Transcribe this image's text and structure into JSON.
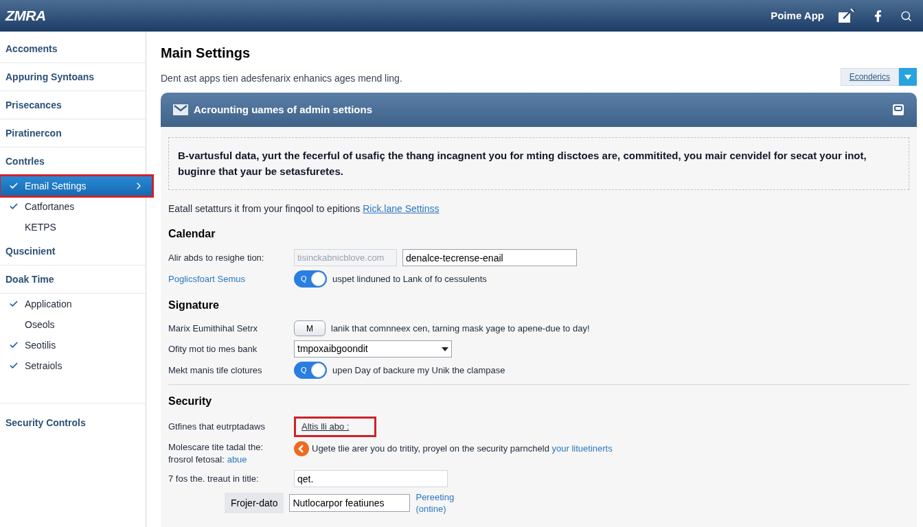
{
  "header": {
    "logo": "ZMRA",
    "app_name": "Poime App"
  },
  "sidebar": {
    "items": [
      {
        "label": "Accoments",
        "kind": "section",
        "selected": false,
        "highlighted": false
      },
      {
        "label": "Appuring Syntoans",
        "kind": "section",
        "selected": false,
        "highlighted": false
      },
      {
        "label": "Prisecances",
        "kind": "section",
        "selected": false,
        "highlighted": false
      },
      {
        "label": "Piratinercon",
        "kind": "section",
        "selected": false,
        "highlighted": false
      },
      {
        "label": "Contrles",
        "kind": "section",
        "selected": false,
        "highlighted": false
      },
      {
        "label": "Email Settings",
        "kind": "sub",
        "checked": true,
        "selected": true,
        "highlighted": true
      },
      {
        "label": "Catfortanes",
        "kind": "sub",
        "checked": true,
        "selected": false,
        "highlighted": false
      },
      {
        "label": "KETPS",
        "kind": "sub",
        "checked": false,
        "selected": false,
        "highlighted": false
      },
      {
        "label": "Quscinient",
        "kind": "section",
        "selected": false,
        "highlighted": false
      },
      {
        "label": "Doak Time",
        "kind": "section",
        "selected": false,
        "highlighted": false
      },
      {
        "label": "Application",
        "kind": "sub",
        "checked": true,
        "selected": false,
        "highlighted": false
      },
      {
        "label": "Oseols",
        "kind": "sub",
        "checked": false,
        "selected": false,
        "highlighted": false
      },
      {
        "label": "Seotilis",
        "kind": "sub",
        "checked": true,
        "selected": false,
        "highlighted": false
      },
      {
        "label": "Setraiols",
        "kind": "sub",
        "checked": true,
        "selected": false,
        "highlighted": false
      },
      {
        "label": "Security Controls",
        "kind": "footer",
        "selected": false,
        "highlighted": false
      }
    ]
  },
  "main": {
    "title": "Main Settings",
    "description": "Dent ast apps tien adesfenarix enhanics ages mend ling.",
    "dropdown": {
      "label": "Econderics"
    },
    "panel": {
      "title": "Acrounting uames of admin settions",
      "notice": "B-vartusful data, yurt the fecerful of usafiç the thang incagnent you for mting disctoes are, commitited, you mair cenvidel for secat your inot, buginre that yaur be setasfuretes.",
      "intro": "Eatall setatturs it from your finqool to epitions",
      "intro_link": "Rick.lane Settinss",
      "sections": [
        {
          "title": "Calendar",
          "divider_before": false,
          "rows": [
            {
              "kind": "fields",
              "label": "Alir abds to resighe tion:",
              "label_link": false,
              "placeholder": "tisinckabnicblove.com",
              "value": "denalce-tecrense-enail"
            },
            {
              "kind": "toggle",
              "label": "Poglicsfoart Semus",
              "label_link": true,
              "on": true,
              "track_text": "Q",
              "text": "uspet linduned to Lank of fo cessulents"
            }
          ]
        },
        {
          "title": "Signature",
          "divider_before": false,
          "rows": [
            {
              "kind": "button",
              "label": "Marix Eumithihal Setrx",
              "label_link": false,
              "button": "M",
              "text": "lanik that comnneex cen, tarning mask yage to apene-due to day!"
            },
            {
              "kind": "select",
              "label": "Ofity mot tio mes bank",
              "label_link": false,
              "value": "tmpoxaibgoondit"
            },
            {
              "kind": "toggle",
              "label": "Mekt manis tife clotures",
              "label_link": false,
              "on": true,
              "track_text": "Q",
              "text": "upen Day of backure my Unik the clampase"
            }
          ]
        },
        {
          "title": "Security",
          "divider_before": true,
          "rows": [
            {
              "kind": "link-box",
              "label": "Gtfines that eutrptadaws",
              "label_link": false,
              "link": "Altis lli abo :",
              "highlighted": true
            },
            {
              "kind": "alert",
              "label": "Molescare tite tadal the:",
              "label2": "frosrol fetosal:",
              "label2_link": "abue",
              "label_link": false,
              "text": "Ugete tlie arer you do tritity, proyel on the security parncheld",
              "link": "your lituetinerts"
            },
            {
              "kind": "input",
              "label": "7 fos the. treaut in title:",
              "label_link": false,
              "value": "qet."
            },
            {
              "kind": "button-input",
              "button": "Frojer-dato",
              "value": "Nutlocarpor featiunes",
              "link": "Pereeting (ontine)"
            }
          ]
        }
      ]
    }
  }
}
